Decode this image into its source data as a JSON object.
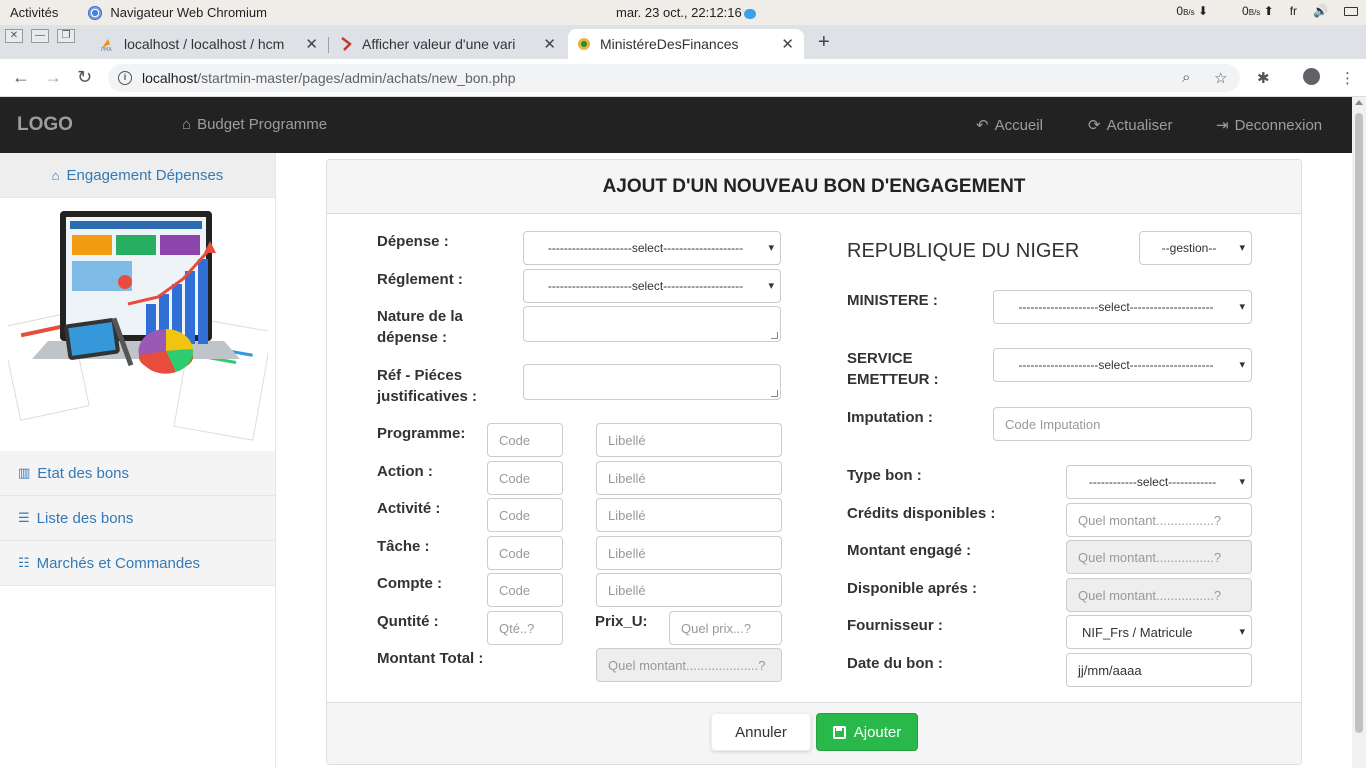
{
  "os_bar": {
    "activities": "Activités",
    "app_name": "Navigateur Web Chromium",
    "clock": "mar. 23 oct., 22:12:16",
    "net_down": "0",
    "net_down_unit": "B/s",
    "net_up": "0",
    "net_up_unit": "B/s",
    "lang": "fr"
  },
  "browser": {
    "tabs": [
      {
        "label": "localhost / localhost / hcm",
        "active": false
      },
      {
        "label": "Afficher valeur d'une vari",
        "active": false
      },
      {
        "label": "MinistéreDesFinances",
        "active": true
      }
    ],
    "url_host": "localhost",
    "url_path": "/startmin-master/pages/admin/achats/new_bon.php"
  },
  "navbar": {
    "logo": "LOGO",
    "brand": "Budget Programme",
    "accueil": "Accueil",
    "actualiser": "Actualiser",
    "deconnexion": "Deconnexion"
  },
  "sidebar": {
    "header": "Engagement Dépenses",
    "items": [
      {
        "label": "Etat des bons",
        "icon": "bar-chart-icon"
      },
      {
        "label": "Liste des bons",
        "icon": "list-icon"
      },
      {
        "label": "Marchés et Commandes",
        "icon": "indent-icon"
      }
    ]
  },
  "form": {
    "title": "AJOUT D'UN NOUVEAU BON D'ENGAGEMENT",
    "left": {
      "depense_label": "Dépense :",
      "depense_value": "---------------------select--------------------",
      "reglement_label": "Réglement :",
      "reglement_value": "---------------------select--------------------",
      "nature_label_1": "Nature de la",
      "nature_label_2": "dépense :",
      "ref_label_1": "Réf - Piéces",
      "ref_label_2": "justificatives :",
      "programme_label": "Programme:",
      "action_label": "Action :",
      "activite_label": "Activité :",
      "tache_label": "Tâche :",
      "compte_label": "Compte :",
      "code_placeholder": "Code",
      "libelle_placeholder": "Libellé",
      "quantite_label": "Quntité :",
      "quantite_placeholder": "Qté..?",
      "prix_label": "Prix_U:",
      "prix_placeholder": "Quel prix...?",
      "montant_total_label": "Montant Total :",
      "montant_total_placeholder": "Quel montant....................?"
    },
    "right": {
      "republique": "REPUBLIQUE DU NIGER",
      "gestion_value": "--gestion--",
      "ministere_label": "MINISTERE :",
      "ministere_value": "--------------------select---------------------",
      "service_label_1": "SERVICE",
      "service_label_2": "EMETTEUR :",
      "service_value": "--------------------select---------------------",
      "imputation_label": "Imputation :",
      "imputation_placeholder": "Code Imputation",
      "type_bon_label": "Type bon :",
      "type_bon_value": "------------select------------",
      "credits_label": "Crédits disponibles :",
      "credits_placeholder": "Quel montant................?",
      "montant_engage_label": "Montant engagé :",
      "montant_engage_placeholder": "Quel montant................?",
      "disponible_label": "Disponible aprés :",
      "disponible_placeholder": "Quel montant................?",
      "fournisseur_label": "Fournisseur :",
      "fournisseur_value": "NIF_Frs / Matricule",
      "date_label": "Date du bon :",
      "date_value": "jj/mm/aaaa"
    },
    "buttons": {
      "annuler": "Annuler",
      "ajouter": "Ajouter"
    }
  },
  "colors": {
    "navbar_bg": "#222222",
    "link": "#337ab7",
    "success": "#28b94a"
  }
}
